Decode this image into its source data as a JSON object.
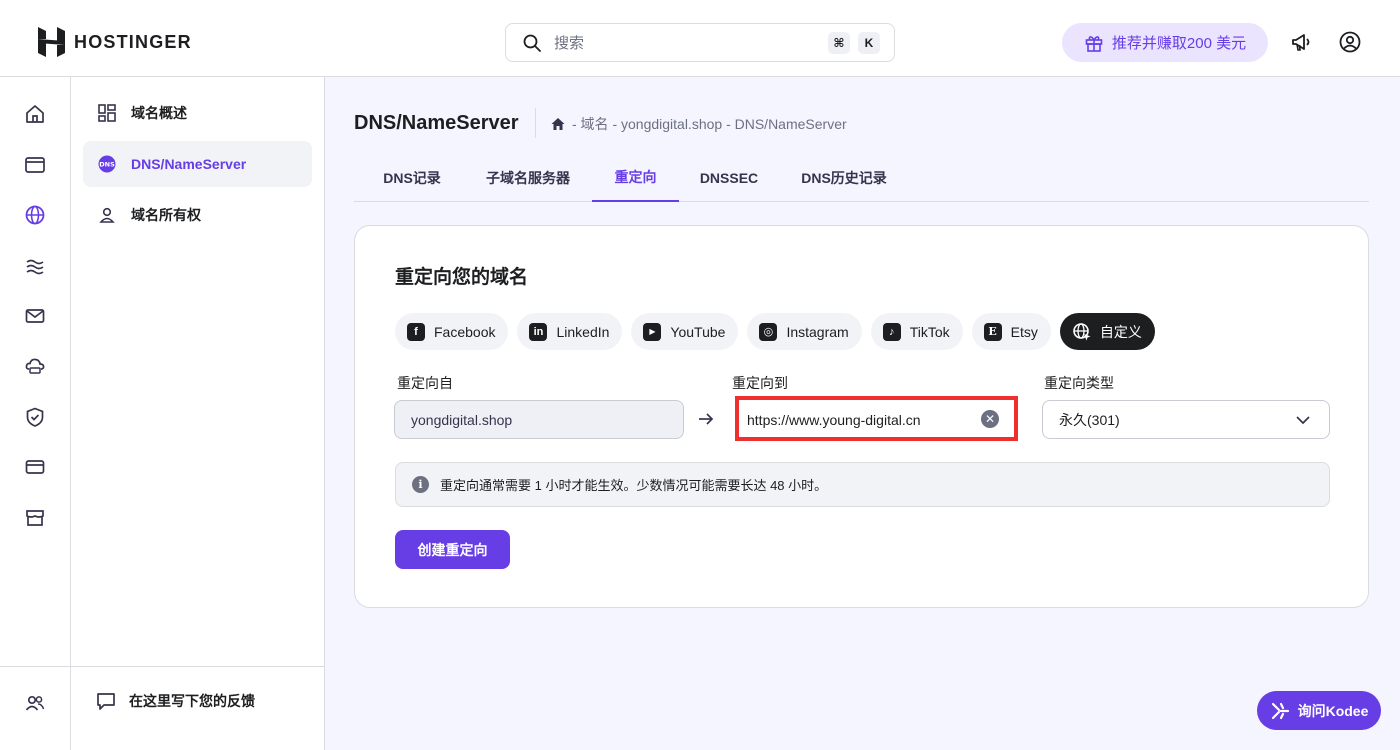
{
  "header": {
    "brand": "HOSTINGER",
    "search_placeholder": "搜索",
    "shortcut_keys": [
      "⌘",
      "K"
    ],
    "referral_label": "推荐并赚取200 美元",
    "icons": [
      "hostinger-logo-icon",
      "search-icon",
      "gift-icon",
      "megaphone-icon",
      "account-icon"
    ]
  },
  "rail": {
    "icons": [
      "home-icon",
      "browser-icon",
      "globe-icon",
      "hosting-icon",
      "mail-icon",
      "cloud-icon",
      "shield-icon",
      "billing-icon",
      "store-icon",
      "users-icon"
    ],
    "active": "globe-icon"
  },
  "sidebar": {
    "items": [
      {
        "label": "域名概述",
        "icon": "dashboard-icon",
        "active": false
      },
      {
        "label": "DNS/NameServer",
        "icon": "dns-icon",
        "active": true
      },
      {
        "label": "域名所有权",
        "icon": "user-icon",
        "active": false
      }
    ],
    "feedback_label": "在这里写下您的反馈"
  },
  "main": {
    "title": "DNS/NameServer",
    "breadcrumb": "- 域名 - yongdigital.shop - DNS/NameServer",
    "tabs": [
      {
        "label": "DNS记录",
        "active": false
      },
      {
        "label": "子域名服务器",
        "active": false
      },
      {
        "label": "重定向",
        "active": true
      },
      {
        "label": "DNSSEC",
        "active": false
      },
      {
        "label": "DNS历史记录",
        "active": false
      }
    ]
  },
  "redirect": {
    "heading": "重定向您的域名",
    "presets": [
      {
        "label": "Facebook",
        "icon": "facebook-icon",
        "glyph": "f"
      },
      {
        "label": "LinkedIn",
        "icon": "linkedin-icon",
        "glyph": "in"
      },
      {
        "label": "YouTube",
        "icon": "youtube-icon",
        "glyph": "▶"
      },
      {
        "label": "Instagram",
        "icon": "instagram-icon",
        "glyph": "◎"
      },
      {
        "label": "TikTok",
        "icon": "tiktok-icon",
        "glyph": "♪"
      },
      {
        "label": "Etsy",
        "icon": "etsy-icon",
        "glyph": "E"
      },
      {
        "label": "自定义",
        "icon": "globe-cursor-icon",
        "active": true
      }
    ],
    "from_label": "重定向自",
    "from_value": "yongdigital.shop",
    "to_label": "重定向到",
    "to_value": "https://www.young-digital.cn",
    "type_label": "重定向类型",
    "type_value": "永久(301)",
    "notice": "重定向通常需要 1 小时才能生效。少数情况可能需要长达 48 小时。",
    "create_label": "创建重定向"
  },
  "assistant": {
    "label": "询问Kodee"
  },
  "colors": {
    "accent": "#673de6",
    "highlight": "#ef2e2e",
    "chip_dark": "#1d1e20"
  }
}
